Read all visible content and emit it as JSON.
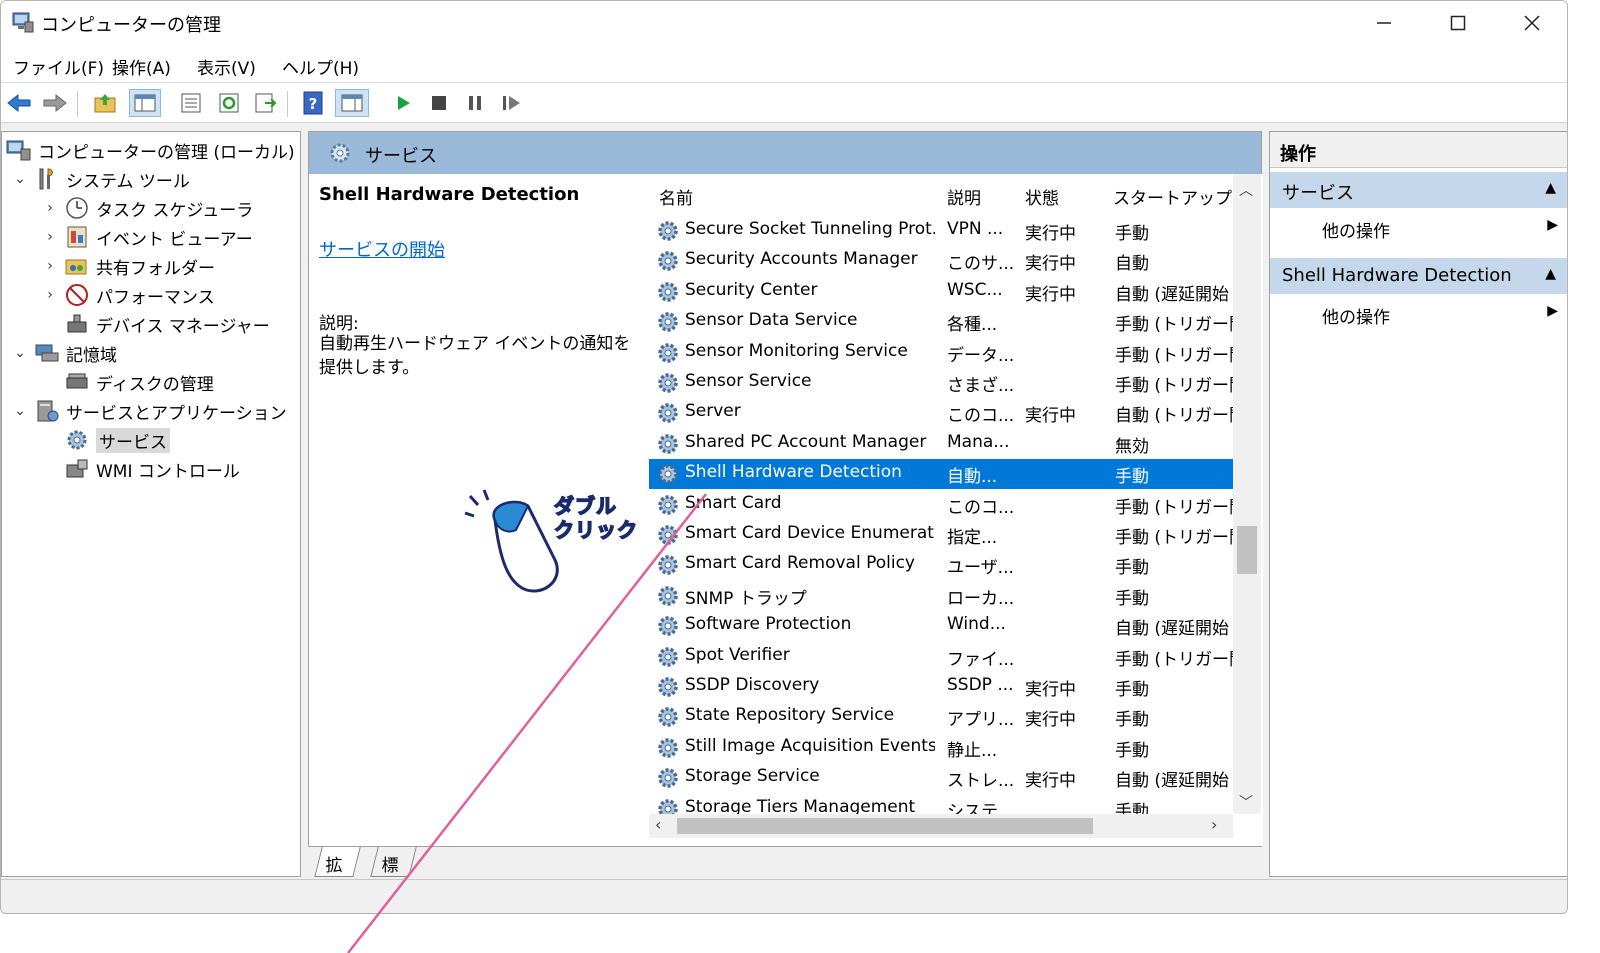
{
  "window": {
    "title": "コンピューターの管理"
  },
  "menu": [
    "ファイル(F)",
    "操作(A)",
    "表示(V)",
    "ヘルプ(H)"
  ],
  "tree": {
    "root": "コンピューターの管理 (ローカル)",
    "system_tools": "システム ツール",
    "task_scheduler": "タスク スケジューラ",
    "event_viewer": "イベント ビューアー",
    "shared_folders": "共有フォルダー",
    "performance": "パフォーマンス",
    "device_manager": "デバイス マネージャー",
    "storage": "記憶域",
    "disk_management": "ディスクの管理",
    "services_apps": "サービスとアプリケーション",
    "services": "サービス",
    "wmi_control": "WMI コントロール"
  },
  "center": {
    "header": "サービス",
    "selected_name": "Shell Hardware Detection",
    "start_link": "サービスの開始",
    "desc_label": "説明:",
    "desc_text": "自動再生ハードウェア イベントの通知を提供します。"
  },
  "columns": {
    "name": "名前",
    "desc": "説明",
    "status": "状態",
    "startup": "スタートアップの種"
  },
  "rows": [
    {
      "name": "Secure Socket Tunneling Prot...",
      "desc": "VPN ...",
      "status": "実行中",
      "startup": "手動"
    },
    {
      "name": "Security Accounts Manager",
      "desc": "このサ...",
      "status": "実行中",
      "startup": "自動"
    },
    {
      "name": "Security Center",
      "desc": "WSC...",
      "status": "実行中",
      "startup": "自動 (遅延開始"
    },
    {
      "name": "Sensor Data Service",
      "desc": "各種...",
      "status": "",
      "startup": "手動 (トリガー開"
    },
    {
      "name": "Sensor Monitoring Service",
      "desc": "データ...",
      "status": "",
      "startup": "手動 (トリガー開"
    },
    {
      "name": "Sensor Service",
      "desc": "さまざ...",
      "status": "",
      "startup": "手動 (トリガー開"
    },
    {
      "name": "Server",
      "desc": "このコ...",
      "status": "実行中",
      "startup": "自動 (トリガー開"
    },
    {
      "name": "Shared PC Account Manager",
      "desc": "Mana...",
      "status": "",
      "startup": "無効"
    },
    {
      "name": "Shell Hardware Detection",
      "desc": "自動...",
      "status": "",
      "startup": "手動"
    },
    {
      "name": "Smart Card",
      "desc": "このコ...",
      "status": "",
      "startup": "手動 (トリガー開"
    },
    {
      "name": "Smart Card Device Enumerati...",
      "desc": "指定...",
      "status": "",
      "startup": "手動 (トリガー開"
    },
    {
      "name": "Smart Card Removal Policy",
      "desc": "ユーザ...",
      "status": "",
      "startup": "手動"
    },
    {
      "name": "SNMP トラップ",
      "desc": "ローカ...",
      "status": "",
      "startup": "手動"
    },
    {
      "name": "Software Protection",
      "desc": "Wind...",
      "status": "",
      "startup": "自動 (遅延開始"
    },
    {
      "name": "Spot Verifier",
      "desc": "ファイ...",
      "status": "",
      "startup": "手動 (トリガー開"
    },
    {
      "name": "SSDP Discovery",
      "desc": "SSDP ...",
      "status": "実行中",
      "startup": "手動"
    },
    {
      "name": "State Repository Service",
      "desc": "アプリ...",
      "status": "実行中",
      "startup": "手動"
    },
    {
      "name": "Still Image Acquisition Events",
      "desc": "静止...",
      "status": "",
      "startup": "手動"
    },
    {
      "name": "Storage Service",
      "desc": "ストレ...",
      "status": "実行中",
      "startup": "自動 (遅延開始"
    },
    {
      "name": "Storage Tiers Management",
      "desc": "システ...",
      "status": "",
      "startup": "手動"
    }
  ],
  "selected_index": 8,
  "tabs": [
    "拡張",
    "標準"
  ],
  "actions": {
    "header": "操作",
    "section1": "サービス",
    "more1": "他の操作",
    "section2": "Shell Hardware Detection",
    "more2": "他の操作"
  },
  "annotation": {
    "line1": "ダブル",
    "line2": "クリック"
  },
  "colors": {
    "selection": "#0078d7",
    "header_blue": "#9ab8d8",
    "action_section": "#c5d7ea",
    "annotation_line": "#e0609a"
  }
}
